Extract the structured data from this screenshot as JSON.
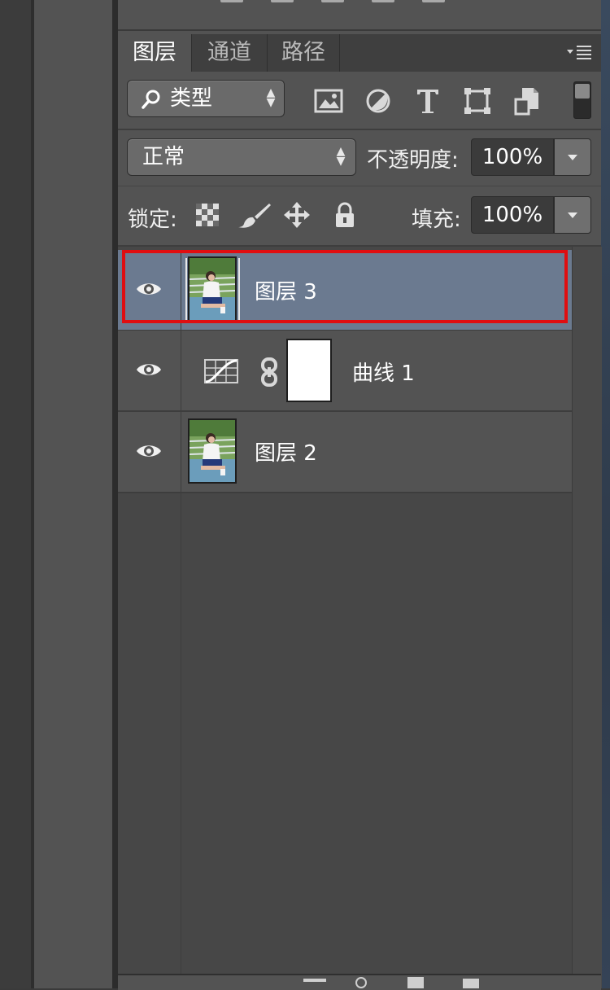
{
  "tabs": [
    "图层",
    "通道",
    "路径"
  ],
  "filter": {
    "label": "类型"
  },
  "blend": {
    "mode": "正常",
    "opacity_label": "不透明度:",
    "opacity_value": "100%"
  },
  "lock": {
    "label": "锁定:",
    "fill_label": "填充:",
    "fill_value": "100%"
  },
  "layers": [
    {
      "name": "图层 3",
      "selected": true
    },
    {
      "name": "曲线 1",
      "selected": false
    },
    {
      "name": "图层 2",
      "selected": false
    }
  ],
  "colors": {
    "selection": "#6b7a90",
    "highlight": "#e00d10"
  }
}
